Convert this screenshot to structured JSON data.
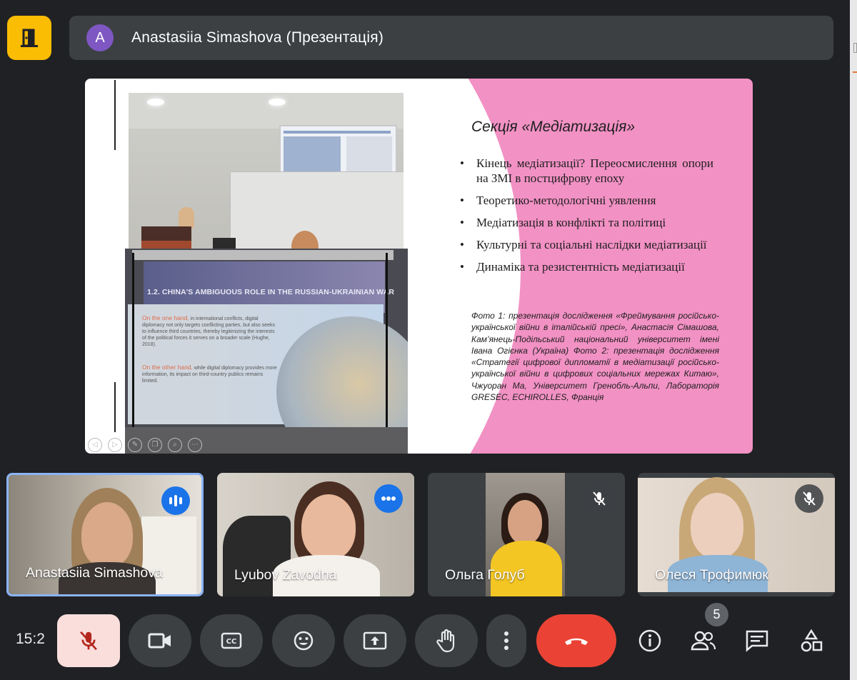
{
  "meeting": {
    "presenter_title": "Anastasiia Simashova (Презентація)",
    "avatar_letter": "A",
    "clock": "15:2",
    "participant_count": "5"
  },
  "colors": {
    "exit": "#fbbc04",
    "end_call": "#ea4335",
    "speaking": "#1a73e8",
    "active_border": "#8ab4f8",
    "slide_pink": "#f291c4"
  },
  "slide": {
    "title": "Секція «Медіатизація»",
    "bullets": [
      "Кінець медіатизації? Переосмислення опори на ЗМІ в постцифрову епоху",
      "Теоретико-методологічні уявлення",
      "Медіатизація в конфлікті та політиці",
      "Культурні та соціальні наслідки медіатизації",
      "Динаміка та резистентність медіатизації"
    ],
    "caption": "Фото 1: презентація дослідження «Фреймування російсько-української війни в італійській пресі», Анастасія Сімашова, Кам’янець-Подільський національний університет імені Івана Огієнка (Україна) Фото 2: презентація дослідження «Стратегії цифрової дипломатії в медіатизації російсько-української війни в цифрових соціальних мережах Китаю», Чжуоран Ма, Університет Гренобль-Альпи, Лабораторія GRESEC, ECHIROLLES, Франція",
    "photo2": {
      "heading": "1.2. CHINA'S AMBIGUOUS ROLE IN THE RUSSIAN-UKRAINIAN WAR",
      "para1_lead": "On the one hand,",
      "para1": " in international conflicts, digital diplomacy not only targets conflicting parties, but also seeks to influence third countries, thereby legitimizing the interests of the political forces it serves on a broader scale (Hughe, 2018).",
      "para2_lead": "On the other hand,",
      "para2": " while digital diplomacy provides more information, its impact on third-country publics remains limited."
    }
  },
  "participants": [
    {
      "name": "Anastasiia Simashova",
      "status": "speaking",
      "active": true
    },
    {
      "name": "Lyubov Zavodna",
      "status": "speaking",
      "active": false
    },
    {
      "name": "Ольга Голуб",
      "status": "muted",
      "active": false
    },
    {
      "name": "Олеся Трофимюк",
      "status": "muted",
      "active": false
    }
  ],
  "controls": {
    "icons": [
      "mic-off-icon",
      "camera-icon",
      "captions-icon",
      "emoji-icon",
      "present-icon",
      "hand-icon",
      "more-icon",
      "end-call-icon",
      "info-icon",
      "people-icon",
      "chat-icon",
      "activities-icon"
    ]
  }
}
